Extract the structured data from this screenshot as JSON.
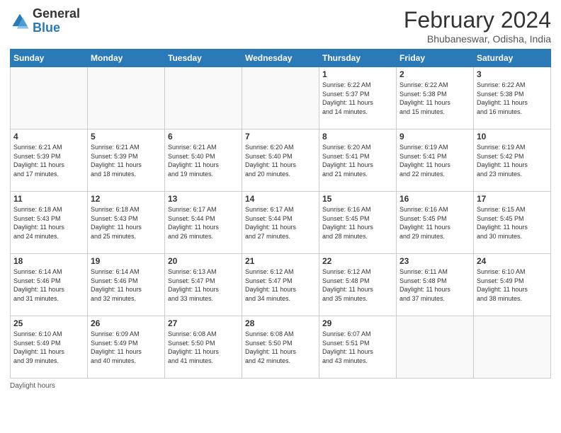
{
  "header": {
    "logo_general": "General",
    "logo_blue": "Blue",
    "title": "February 2024",
    "location": "Bhubaneswar, Odisha, India"
  },
  "days_of_week": [
    "Sunday",
    "Monday",
    "Tuesday",
    "Wednesday",
    "Thursday",
    "Friday",
    "Saturday"
  ],
  "weeks": [
    [
      {
        "day": "",
        "info": ""
      },
      {
        "day": "",
        "info": ""
      },
      {
        "day": "",
        "info": ""
      },
      {
        "day": "",
        "info": ""
      },
      {
        "day": "1",
        "info": "Sunrise: 6:22 AM\nSunset: 5:37 PM\nDaylight: 11 hours\nand 14 minutes."
      },
      {
        "day": "2",
        "info": "Sunrise: 6:22 AM\nSunset: 5:38 PM\nDaylight: 11 hours\nand 15 minutes."
      },
      {
        "day": "3",
        "info": "Sunrise: 6:22 AM\nSunset: 5:38 PM\nDaylight: 11 hours\nand 16 minutes."
      }
    ],
    [
      {
        "day": "4",
        "info": "Sunrise: 6:21 AM\nSunset: 5:39 PM\nDaylight: 11 hours\nand 17 minutes."
      },
      {
        "day": "5",
        "info": "Sunrise: 6:21 AM\nSunset: 5:39 PM\nDaylight: 11 hours\nand 18 minutes."
      },
      {
        "day": "6",
        "info": "Sunrise: 6:21 AM\nSunset: 5:40 PM\nDaylight: 11 hours\nand 19 minutes."
      },
      {
        "day": "7",
        "info": "Sunrise: 6:20 AM\nSunset: 5:40 PM\nDaylight: 11 hours\nand 20 minutes."
      },
      {
        "day": "8",
        "info": "Sunrise: 6:20 AM\nSunset: 5:41 PM\nDaylight: 11 hours\nand 21 minutes."
      },
      {
        "day": "9",
        "info": "Sunrise: 6:19 AM\nSunset: 5:41 PM\nDaylight: 11 hours\nand 22 minutes."
      },
      {
        "day": "10",
        "info": "Sunrise: 6:19 AM\nSunset: 5:42 PM\nDaylight: 11 hours\nand 23 minutes."
      }
    ],
    [
      {
        "day": "11",
        "info": "Sunrise: 6:18 AM\nSunset: 5:43 PM\nDaylight: 11 hours\nand 24 minutes."
      },
      {
        "day": "12",
        "info": "Sunrise: 6:18 AM\nSunset: 5:43 PM\nDaylight: 11 hours\nand 25 minutes."
      },
      {
        "day": "13",
        "info": "Sunrise: 6:17 AM\nSunset: 5:44 PM\nDaylight: 11 hours\nand 26 minutes."
      },
      {
        "day": "14",
        "info": "Sunrise: 6:17 AM\nSunset: 5:44 PM\nDaylight: 11 hours\nand 27 minutes."
      },
      {
        "day": "15",
        "info": "Sunrise: 6:16 AM\nSunset: 5:45 PM\nDaylight: 11 hours\nand 28 minutes."
      },
      {
        "day": "16",
        "info": "Sunrise: 6:16 AM\nSunset: 5:45 PM\nDaylight: 11 hours\nand 29 minutes."
      },
      {
        "day": "17",
        "info": "Sunrise: 6:15 AM\nSunset: 5:45 PM\nDaylight: 11 hours\nand 30 minutes."
      }
    ],
    [
      {
        "day": "18",
        "info": "Sunrise: 6:14 AM\nSunset: 5:46 PM\nDaylight: 11 hours\nand 31 minutes."
      },
      {
        "day": "19",
        "info": "Sunrise: 6:14 AM\nSunset: 5:46 PM\nDaylight: 11 hours\nand 32 minutes."
      },
      {
        "day": "20",
        "info": "Sunrise: 6:13 AM\nSunset: 5:47 PM\nDaylight: 11 hours\nand 33 minutes."
      },
      {
        "day": "21",
        "info": "Sunrise: 6:12 AM\nSunset: 5:47 PM\nDaylight: 11 hours\nand 34 minutes."
      },
      {
        "day": "22",
        "info": "Sunrise: 6:12 AM\nSunset: 5:48 PM\nDaylight: 11 hours\nand 35 minutes."
      },
      {
        "day": "23",
        "info": "Sunrise: 6:11 AM\nSunset: 5:48 PM\nDaylight: 11 hours\nand 37 minutes."
      },
      {
        "day": "24",
        "info": "Sunrise: 6:10 AM\nSunset: 5:49 PM\nDaylight: 11 hours\nand 38 minutes."
      }
    ],
    [
      {
        "day": "25",
        "info": "Sunrise: 6:10 AM\nSunset: 5:49 PM\nDaylight: 11 hours\nand 39 minutes."
      },
      {
        "day": "26",
        "info": "Sunrise: 6:09 AM\nSunset: 5:49 PM\nDaylight: 11 hours\nand 40 minutes."
      },
      {
        "day": "27",
        "info": "Sunrise: 6:08 AM\nSunset: 5:50 PM\nDaylight: 11 hours\nand 41 minutes."
      },
      {
        "day": "28",
        "info": "Sunrise: 6:08 AM\nSunset: 5:50 PM\nDaylight: 11 hours\nand 42 minutes."
      },
      {
        "day": "29",
        "info": "Sunrise: 6:07 AM\nSunset: 5:51 PM\nDaylight: 11 hours\nand 43 minutes."
      },
      {
        "day": "",
        "info": ""
      },
      {
        "day": "",
        "info": ""
      }
    ]
  ],
  "footer": {
    "daylight_label": "Daylight hours"
  }
}
